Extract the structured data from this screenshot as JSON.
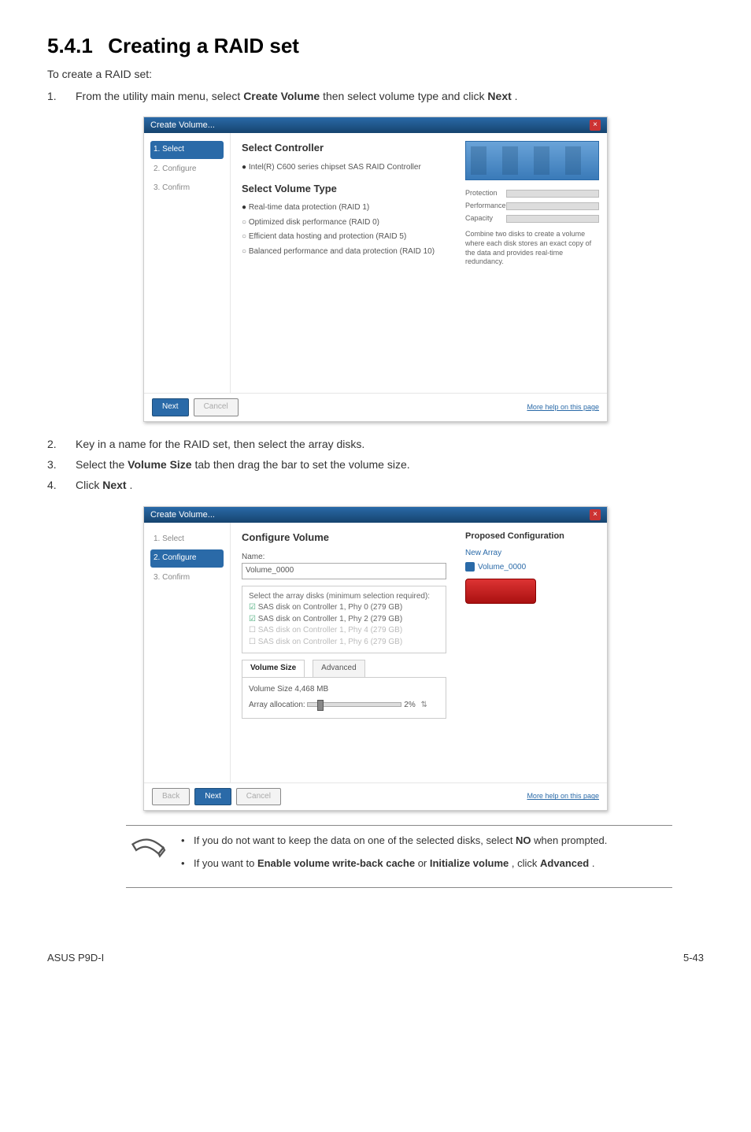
{
  "section": {
    "number": "5.4.1",
    "title": "Creating a RAID set",
    "intro": "To create a RAID set:",
    "step1_a": "From the utility main menu, select ",
    "step1_b": "Create Volume",
    "step1_c": " then select volume type and click ",
    "step1_d": "Next",
    "step1_e": ".",
    "step2": "Key in a name for the RAID set, then select the array disks.",
    "step3_a": "Select the ",
    "step3_b": "Volume Size",
    "step3_c": " tab then drag the bar to set the volume size.",
    "step4_a": "Click ",
    "step4_b": "Next",
    "step4_c": "."
  },
  "wizard1": {
    "title": "Create Volume...",
    "side": {
      "s1": "1. Select",
      "s2": "2. Configure",
      "s3": "3. Confirm"
    },
    "h_controller": "Select Controller",
    "controller": "Intel(R) C600 series chipset SAS RAID Controller",
    "h_type": "Select Volume Type",
    "opt1": "Real-time data protection (RAID 1)",
    "opt2": "Optimized disk performance (RAID 0)",
    "opt3": "Efficient data hosting and protection (RAID 5)",
    "opt4": "Balanced performance and data protection (RAID 10)",
    "bars": {
      "protection": "Protection",
      "performance": "Performance",
      "capacity": "Capacity"
    },
    "desc": "Combine two disks to create a volume where each disk stores an exact copy of the data and provides real-time redundancy.",
    "next": "Next",
    "cancel": "Cancel",
    "more": "More help on this page"
  },
  "wizard2": {
    "title": "Create Volume...",
    "side": {
      "s1": "1. Select",
      "s2": "2. Configure",
      "s3": "3. Confirm"
    },
    "h": "Configure Volume",
    "name_lbl": "Name:",
    "name_val": "Volume_0000",
    "disks_hint": "Select the array disks (minimum selection required):",
    "d1": "SAS disk on Controller 1, Phy 0 (279 GB)",
    "d2": "SAS disk on Controller 1, Phy 2 (279 GB)",
    "d3": "SAS disk on Controller 1, Phy 4 (279 GB)",
    "d4": "SAS disk on Controller 1, Phy 6 (279 GB)",
    "tab_size": "Volume Size",
    "tab_adv": "Advanced",
    "vol_line": "Volume Size 4,468 MB",
    "alloc_lbl": "Array allocation:",
    "alloc_pct": "2%",
    "proposed": "Proposed Configuration",
    "new_array": "New Array",
    "vol_item": "Volume_0000",
    "back": "Back",
    "next": "Next",
    "cancel": "Cancel",
    "more": "More help on this page"
  },
  "note": {
    "li1_a": "If you do not want to keep the data on one of the selected disks, select ",
    "li1_b": "NO",
    "li1_c": " when prompted.",
    "li2_a": "If you want to ",
    "li2_b": "Enable volume write-back cache",
    "li2_c": " or ",
    "li2_d": "Initialize volume",
    "li2_e": ", click ",
    "li2_f": "Advanced",
    "li2_g": "."
  },
  "footer": {
    "left": "ASUS P9D-I",
    "right": "5-43"
  }
}
